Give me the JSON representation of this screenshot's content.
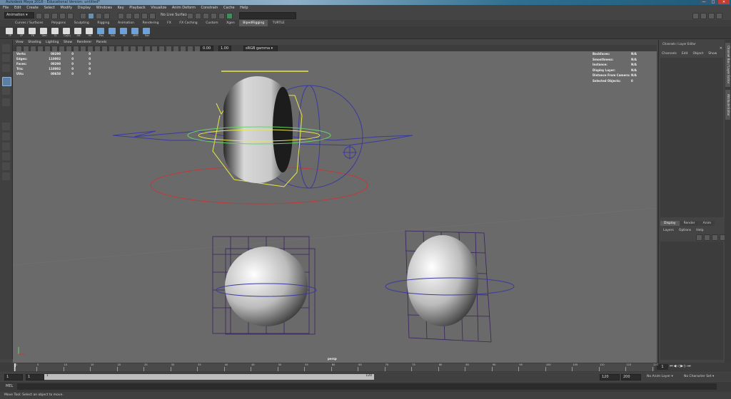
{
  "window": {
    "title": "Autodesk Maya 2016 - Educational Version: untitled*",
    "min": "—",
    "max": "□",
    "close": "✕"
  },
  "menubar": [
    "File",
    "Edit",
    "Create",
    "Select",
    "Modify",
    "Display",
    "Windows",
    "Key",
    "Playback",
    "Visualize",
    "Anim Deform",
    "Constrain",
    "Cache",
    "Help"
  ],
  "statusline": {
    "mode": "Animation",
    "surface": "No Live Surface"
  },
  "shelf_tabs": [
    "Curves / Surfaces",
    "Polygons",
    "Sculpting",
    "Rigging",
    "Animation",
    "Rendering",
    "FX",
    "FX Caching",
    "Custom",
    "Xgen",
    "BipedRigging",
    "TURTLE"
  ],
  "shelf_active": "BipedRigging",
  "shelf_icons": [
    "TP",
    "CP",
    "FK",
    "Gen",
    "CL",
    "Cp(h)",
    "AN",
    "HK",
    "Pos",
    "IKA",
    "IK",
    "MPR",
    "Sec"
  ],
  "viewport": {
    "menu": [
      "View",
      "Shading",
      "Lighting",
      "Show",
      "Renderer",
      "Panels"
    ],
    "frame": "0.00",
    "scale": "1.00",
    "colorspace": "sRGB gamma",
    "camera": "persp",
    "hud_left": [
      {
        "label": "Verts:",
        "v1": "00298",
        "v2": "0",
        "v3": "0"
      },
      {
        "label": "Edges:",
        "v1": "110002",
        "v2": "0",
        "v3": "0"
      },
      {
        "label": "Faces:",
        "v1": "00298",
        "v2": "0",
        "v3": "0"
      },
      {
        "label": "Tris:",
        "v1": "110002",
        "v2": "0",
        "v3": "0"
      },
      {
        "label": "UVs:",
        "v1": "00658",
        "v2": "0",
        "v3": "0"
      }
    ],
    "hud_right": [
      {
        "label": "Backfaces:",
        "value": "N/A"
      },
      {
        "label": "Smoothness:",
        "value": "N/A"
      },
      {
        "label": "Instance:",
        "value": "N/A"
      },
      {
        "label": "Display Layer:",
        "value": "N/A"
      },
      {
        "label": "Distance From Camera:",
        "value": "N/A"
      },
      {
        "label": "Selected Objects:",
        "value": "0"
      }
    ]
  },
  "channelbox": {
    "title": "Channels / Layer Editor",
    "menu": [
      "Channels",
      "Edit",
      "Object",
      "Show"
    ]
  },
  "layereditor": {
    "tabs": [
      "Display",
      "Render",
      "Anim"
    ],
    "menu": [
      "Layers",
      "Options",
      "Help"
    ]
  },
  "side_tabs": [
    "Channel Box / Layer Editor",
    "Attribute Editor"
  ],
  "timeslider": {
    "ticks": [
      "1",
      "5",
      "10",
      "15",
      "20",
      "25",
      "30",
      "35",
      "40",
      "45",
      "50",
      "55",
      "60",
      "65",
      "70",
      "75",
      "80",
      "85",
      "90",
      "95",
      "100",
      "105",
      "110",
      "115",
      "120"
    ],
    "current": "1"
  },
  "range": {
    "start": "1",
    "start2": "1",
    "mid": "1",
    "end_inner": "120",
    "end": "120",
    "end2": "200",
    "anim_layer": "No Anim Layer",
    "char_set": "No Character Set"
  },
  "mel": {
    "label": "MEL"
  },
  "help": "Move Tool: Select an object to move."
}
